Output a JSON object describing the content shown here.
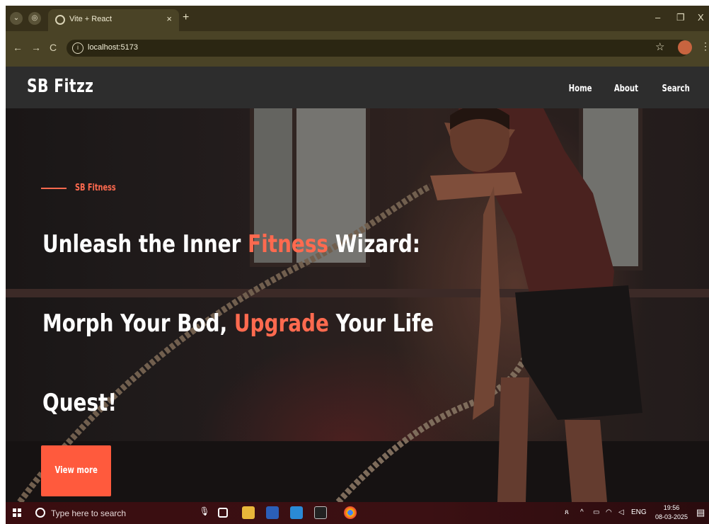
{
  "browser": {
    "tab_title": "Vite + React",
    "tab_close": "×",
    "new_tab": "+",
    "url": "localhost:5173",
    "nav_back": "←",
    "nav_forward": "→",
    "nav_reload": "C",
    "win_minimize": "–",
    "win_restore": "❐",
    "win_close": "X",
    "star": "☆",
    "menu": "⋮"
  },
  "site": {
    "brand": "SB Fitzz",
    "nav": [
      "Home",
      "About",
      "Search"
    ],
    "hero": {
      "eyebrow": "SB Fitness",
      "line1_a": "Unleash the Inner ",
      "line1_b": "Fitness",
      "line1_c": " Wizard:",
      "line2_a": "Morph Your Bod, ",
      "line2_b": "Upgrade",
      "line2_c": " Your Life",
      "line3": "Quest!",
      "cta": "View more"
    },
    "colors": {
      "accent": "#ff5a3d",
      "nav_bg": "#2d2d2d"
    }
  },
  "taskbar": {
    "search_placeholder": "Type here to search",
    "lang": "ENG",
    "time": "19:56",
    "date": "08-03-2025"
  }
}
